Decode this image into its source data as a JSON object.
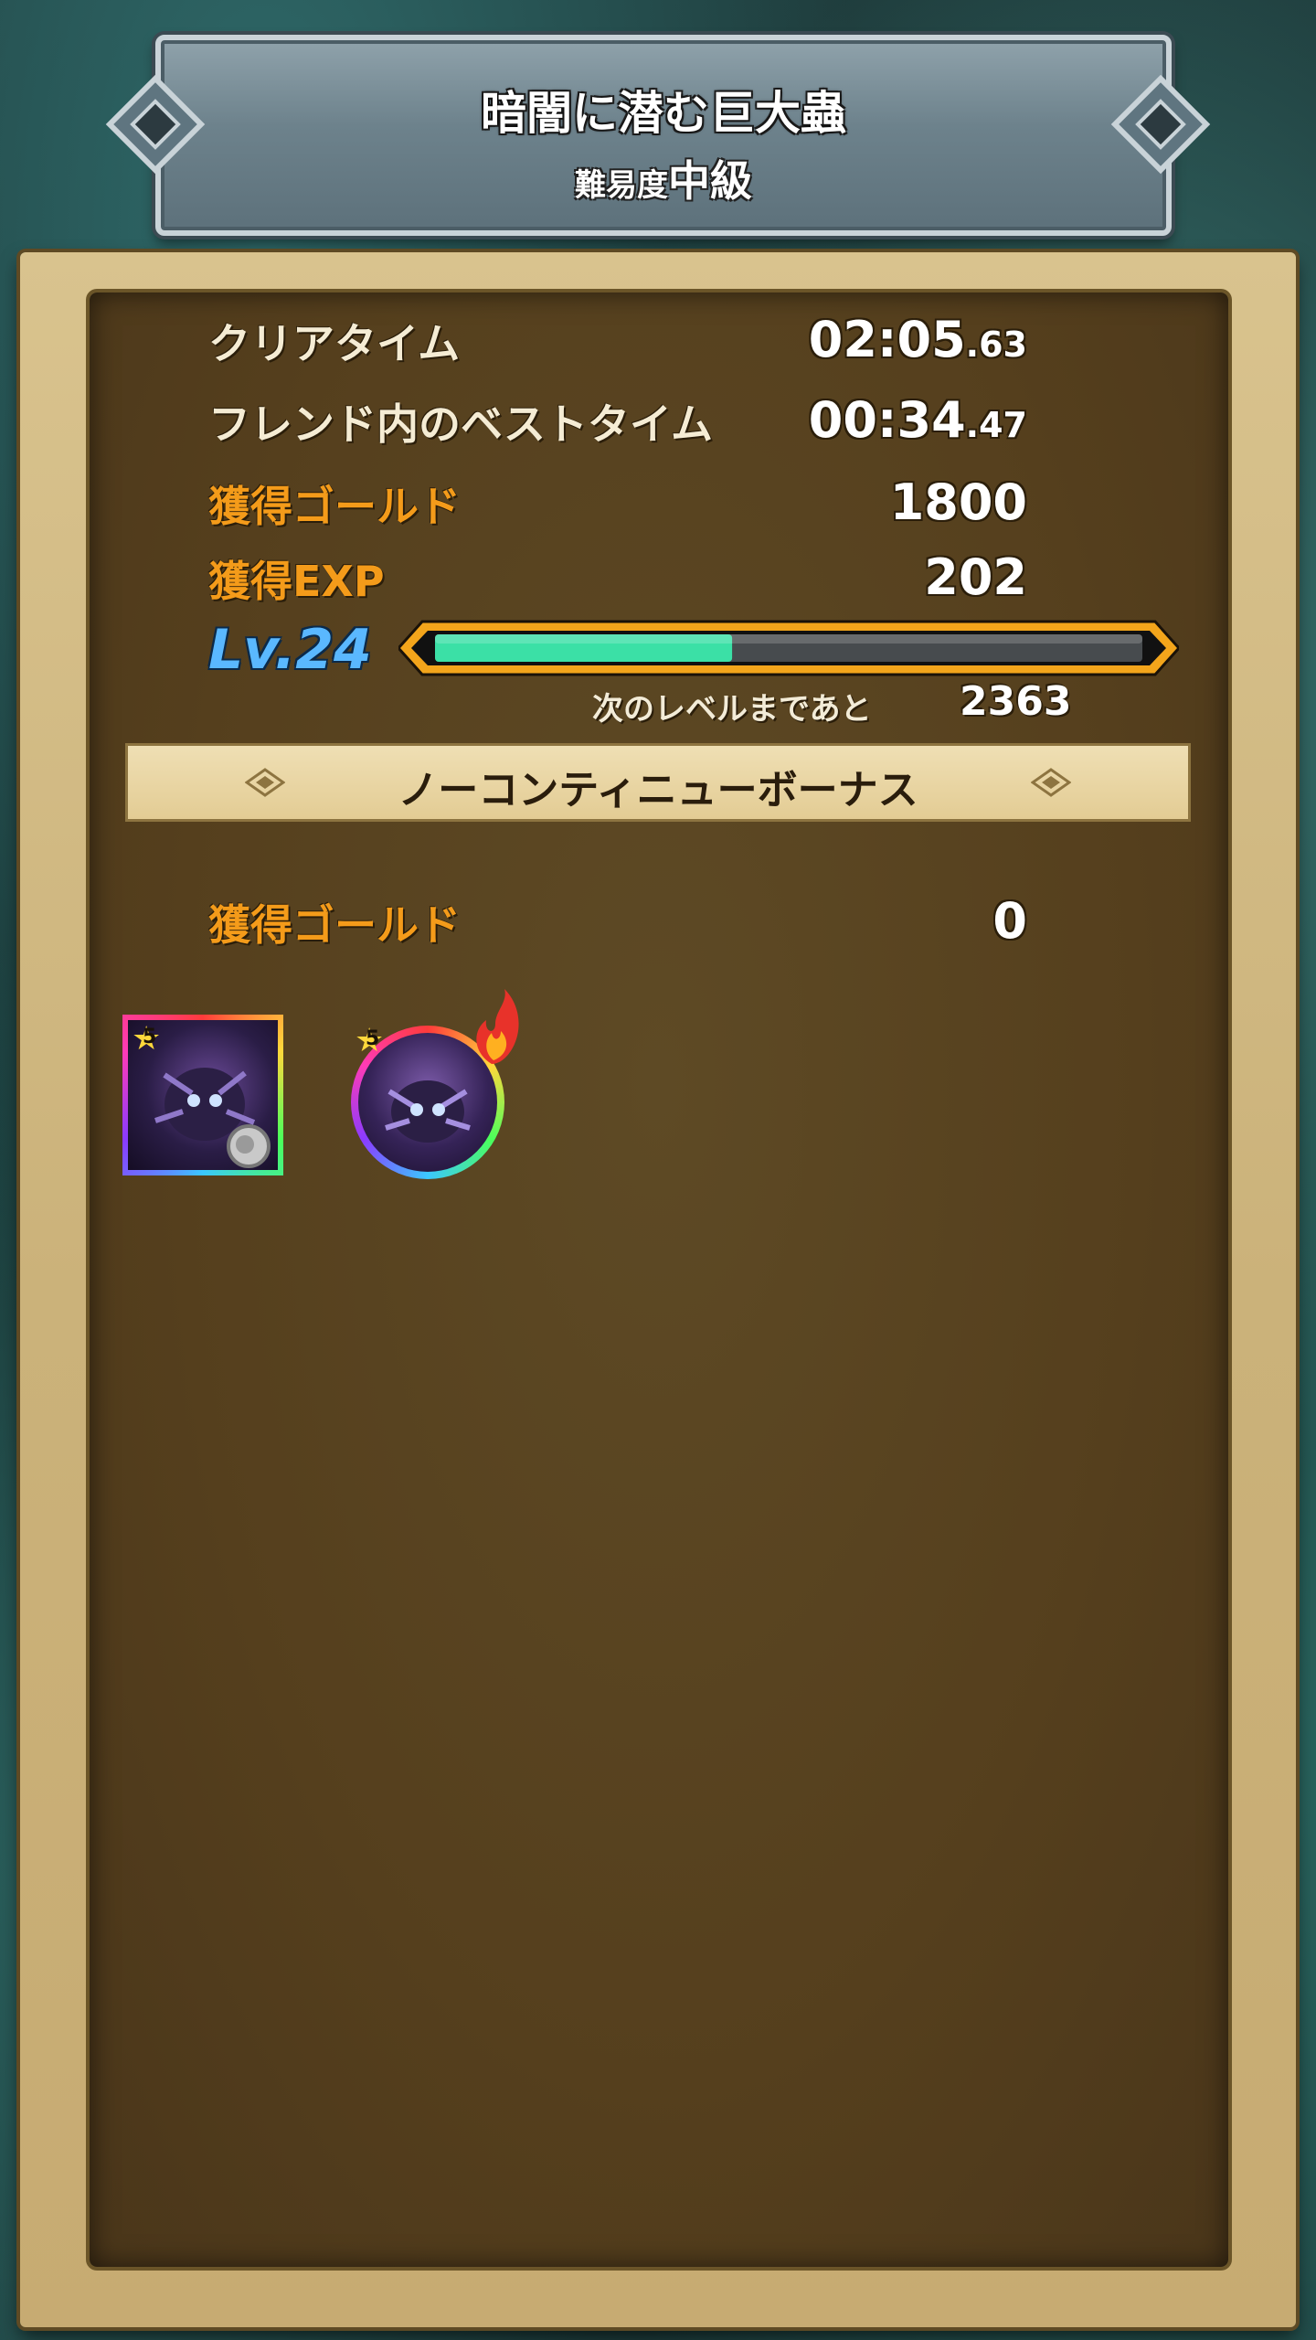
{
  "header": {
    "quest_title": "暗闇に潜む巨大蟲",
    "difficulty_label": "難易度",
    "difficulty_value": "中級"
  },
  "results": {
    "clear_time_label": "クリアタイム",
    "clear_time_main": "02:05",
    "clear_time_frac": ".63",
    "best_time_label": "フレンド内のベストタイム",
    "best_time_main": "00:34",
    "best_time_frac": ".47",
    "gold_label": "獲得ゴールド",
    "gold_value": "1800",
    "exp_label": "獲得EXP",
    "exp_value": "202"
  },
  "level": {
    "level_text": "Lv.24",
    "progress_fraction": 0.42,
    "next_label": "次のレベルまであと",
    "next_value": "2363"
  },
  "bonus": {
    "title": "ノーコンティニューボーナス",
    "gold_label": "獲得ゴールド",
    "gold_value": "0"
  },
  "drops": {
    "card_stars": "5",
    "medal_stars": "5"
  },
  "colors": {
    "label_white": "#f5ecd4",
    "label_orange": "#f49b1a",
    "level_blue": "#5ab8ff",
    "exp_fill": "#3be0a6"
  }
}
